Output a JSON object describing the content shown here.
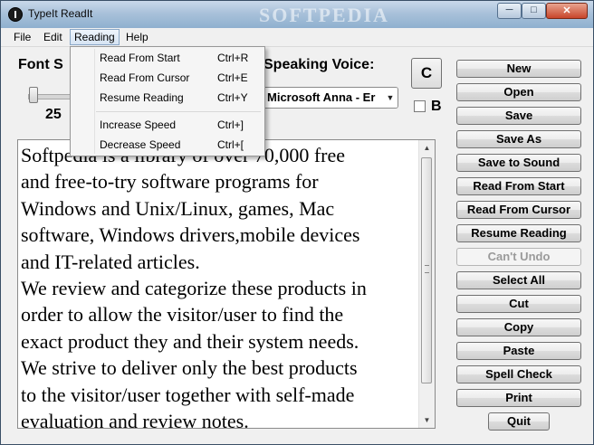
{
  "window": {
    "title": "TypeIt ReadIt",
    "watermark": "SOFTPEDIA",
    "caption": {
      "minimize": "─",
      "maximize": "□",
      "close": "✕"
    }
  },
  "menubar": {
    "items": [
      {
        "label": "File"
      },
      {
        "label": "Edit"
      },
      {
        "label": "Reading"
      },
      {
        "label": "Help"
      }
    ]
  },
  "reading_menu": {
    "items": [
      {
        "label": "Read From Start",
        "shortcut": "Ctrl+R"
      },
      {
        "label": "Read From Cursor",
        "shortcut": "Ctrl+E"
      },
      {
        "label": "Resume Reading",
        "shortcut": "Ctrl+Y"
      },
      {
        "label": "Increase Speed",
        "shortcut": "Ctrl+]"
      },
      {
        "label": "Decrease Speed",
        "shortcut": "Ctrl+["
      }
    ]
  },
  "controls": {
    "font_size_label": "Font S",
    "font_size_value": "25",
    "speaking_voice_label": "Speaking Voice:",
    "voice_selected": "Microsoft Anna - Er",
    "c_button": "C",
    "b_label": "B"
  },
  "editor": {
    "text": "Softpedia is a library of over 70,000 free\nand free-to-try software programs for\nWindows and Unix/Linux, games, Mac\nsoftware, Windows drivers,mobile devices\nand IT-related articles.\nWe review and categorize these products in\norder to allow the visitor/user to find the\nexact product they and their system needs.\nWe strive to deliver only the best products\nto the visitor/user together with self-made\nevaluation and review notes."
  },
  "buttons": {
    "new": "New",
    "open": "Open",
    "save": "Save",
    "save_as": "Save As",
    "save_to_sound": "Save to Sound",
    "read_from_start": "Read From Start",
    "read_from_cursor": "Read From Cursor",
    "resume_reading": "Resume Reading",
    "cant_undo": "Can't Undo",
    "select_all": "Select All",
    "cut": "Cut",
    "copy": "Copy",
    "paste": "Paste",
    "spell_check": "Spell Check",
    "print": "Print",
    "quit": "Quit"
  }
}
